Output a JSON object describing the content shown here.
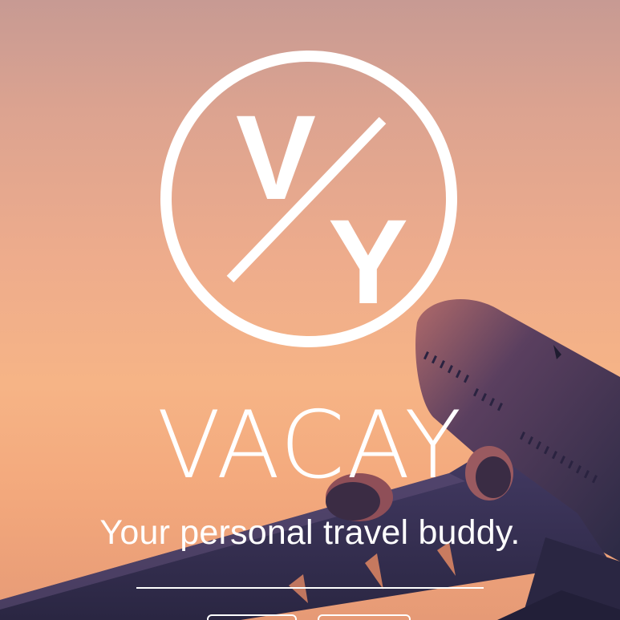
{
  "brand": {
    "logo_letter_top": "V",
    "logo_letter_bottom": "Y",
    "name": "VACAY",
    "tagline": "Your personal travel buddy."
  },
  "buttons": [
    {
      "label": ""
    },
    {
      "label": ""
    }
  ],
  "colors": {
    "text": "#ffffff",
    "sky_top": "#c79a93",
    "sky_bottom": "#f3a87c",
    "airplane": "#3c3559"
  }
}
